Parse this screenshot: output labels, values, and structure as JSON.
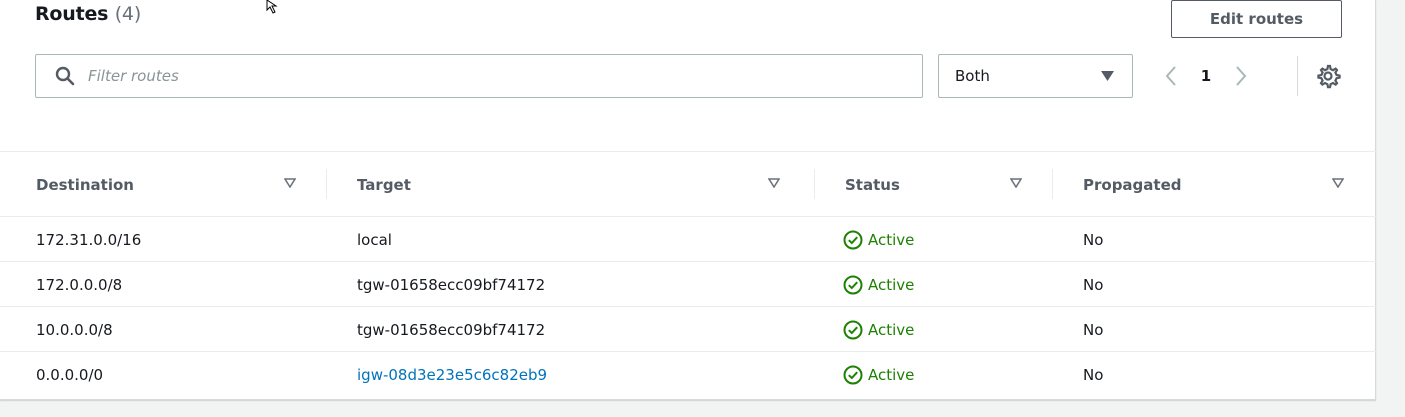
{
  "header": {
    "title": "Routes",
    "count": "(4)",
    "edit_button": "Edit routes"
  },
  "filter": {
    "placeholder": "Filter routes",
    "value": ""
  },
  "select": {
    "value": "Both"
  },
  "pagination": {
    "current_page": "1"
  },
  "table": {
    "columns": [
      "Destination",
      "Target",
      "Status",
      "Propagated"
    ],
    "rows": [
      {
        "destination": "172.31.0.0/16",
        "target": "local",
        "target_is_link": false,
        "status": "Active",
        "propagated": "No"
      },
      {
        "destination": "172.0.0.0/8",
        "target": "tgw-01658ecc09bf74172",
        "target_is_link": false,
        "status": "Active",
        "propagated": "No"
      },
      {
        "destination": "10.0.0.0/8",
        "target": "tgw-01658ecc09bf74172",
        "target_is_link": false,
        "status": "Active",
        "propagated": "No"
      },
      {
        "destination": "0.0.0.0/0",
        "target": "igw-08d3e23e5c6c82eb9",
        "target_is_link": true,
        "status": "Active",
        "propagated": "No"
      }
    ]
  },
  "colors": {
    "link": "#0073bb",
    "status_active": "#1d8102",
    "border": "#aab7b8",
    "text": "#16191f"
  },
  "icons": {
    "search": "search-icon",
    "caret": "caret-down-icon",
    "prev": "chevron-left-icon",
    "next": "chevron-right-icon",
    "settings": "gear-icon",
    "sort": "sort-icon",
    "status": "check-circle-icon"
  }
}
